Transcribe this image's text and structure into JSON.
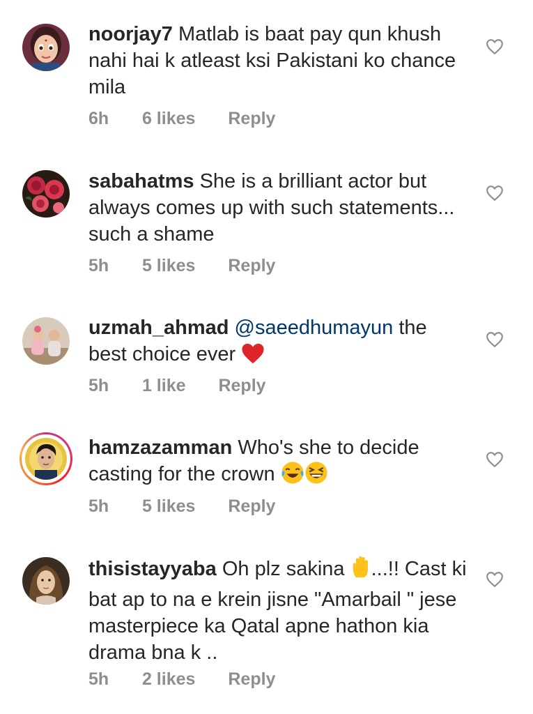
{
  "comments": [
    {
      "username": "noorjay7",
      "text": "Matlab is baat pay qun khush nahi hai k atleast ksi Pakistani ko chance mila",
      "time": "6h",
      "likes": "6 likes",
      "reply": "Reply",
      "avatar_icon": "cartoon-girl-avatar"
    },
    {
      "username": "sabahatms",
      "text": "She is a brilliant actor but always comes up with such statements... such a shame",
      "time": "5h",
      "likes": "5 likes",
      "reply": "Reply",
      "avatar_icon": "red-roses-avatar"
    },
    {
      "username": "uzmah_ahmad",
      "mention": "@saeedhumayun",
      "text": "the best choice ever",
      "emoji": "red-heart-emoji",
      "time": "5h",
      "likes": "1 like",
      "reply": "Reply",
      "avatar_icon": "two-children-avatar"
    },
    {
      "username": "hamzazamman",
      "text": "Who's she to decide casting for the crown",
      "emoji": [
        "tears-of-joy-emoji",
        "grinning-squinting-emoji"
      ],
      "time": "5h",
      "likes": "5 likes",
      "reply": "Reply",
      "avatar_icon": "young-man-avatar",
      "story_ring": true
    },
    {
      "username": "thisistayyaba",
      "text_before_emoji": "Oh plz sakina",
      "emoji": "raised-hand-emoji",
      "text": "...!! Cast ki bat ap to na e krein jisne \"Amarbail \" jese masterpiece ka Qatal apne hathon kia drama bna k ..",
      "time": "5h",
      "likes": "2 likes",
      "reply": "Reply",
      "avatar_icon": "woman-portrait-avatar"
    }
  ],
  "colors": {
    "text": "#262626",
    "meta": "#8e8e8e",
    "mention": "#00376b",
    "heart_outline": "#8e8e8e"
  }
}
